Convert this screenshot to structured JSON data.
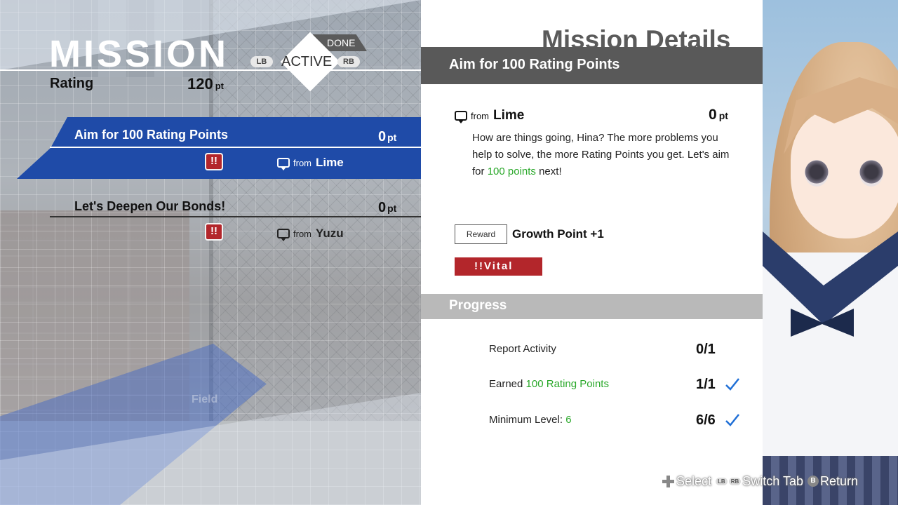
{
  "header": {
    "title": "MISSION",
    "rating_label": "Rating",
    "rating_value": "120",
    "rating_unit": "pt"
  },
  "tabs": {
    "active": "ACTIVE",
    "done": "DONE",
    "lb": "LB",
    "rb": "RB"
  },
  "missions": [
    {
      "title": "Aim for 100 Rating Points",
      "points": "0",
      "unit": "pt",
      "from_label": "from",
      "from": "Lime",
      "badge": "!!",
      "selected": true
    },
    {
      "title": "Let's Deepen Our Bonds!",
      "points": "0",
      "unit": "pt",
      "from_label": "from",
      "from": "Yuzu",
      "badge": "!!",
      "selected": false
    }
  ],
  "scene": {
    "field_text": "Field"
  },
  "details": {
    "heading": "Mission Details",
    "title": "Aim for 100 Rating Points",
    "from_label": "from",
    "from": "Lime",
    "points": "0",
    "unit": "pt",
    "message_1": "How are things going, Hina? The more problems you help to solve, the more Rating Points you get. Let's aim for ",
    "message_highlight": "100 points",
    "message_2": " next!",
    "reward_label": "Reward",
    "reward_value": "Growth Point +1",
    "vital_label": "!!Vital",
    "progress_label": "Progress",
    "progress": [
      {
        "label": "Report Activity",
        "highlight": "",
        "value": "0/1",
        "done": false
      },
      {
        "label": "Earned ",
        "highlight": "100 Rating Points",
        "value": "1/1",
        "done": true
      },
      {
        "label": "Minimum Level: ",
        "highlight": "6",
        "value": "6/6",
        "done": true
      }
    ]
  },
  "footer": {
    "select": "Select",
    "lb": "LB",
    "rb": "RB",
    "switch_tab": "Switch Tab",
    "b": "B",
    "return": "Return"
  },
  "colors": {
    "selected_band": "#1f4ba8",
    "vital_red": "#b3262b",
    "highlight_green": "#2aa82a",
    "check_blue": "#1f6fd6"
  }
}
